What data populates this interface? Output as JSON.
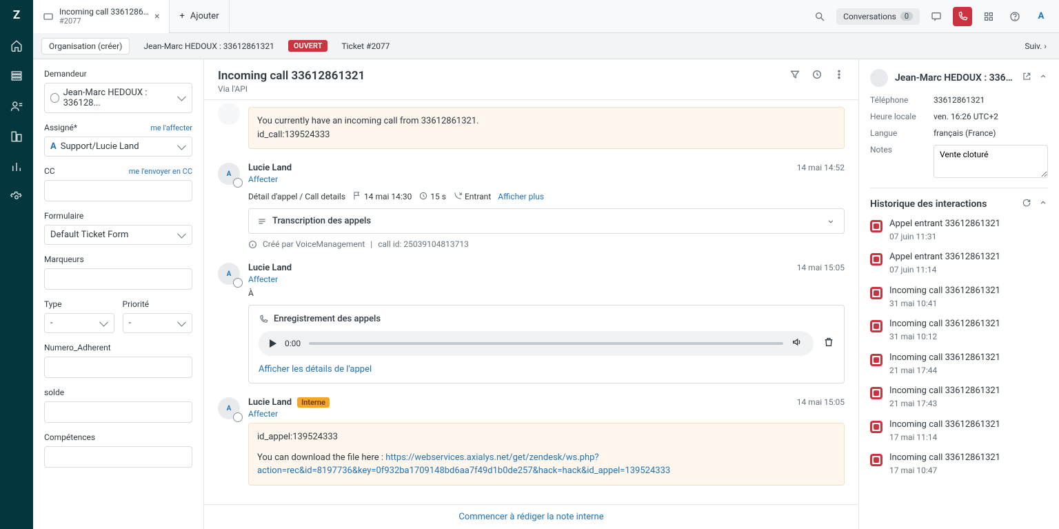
{
  "tab": {
    "title": "Incoming call 3361286...",
    "sub": "#2077",
    "add": "Ajouter"
  },
  "topbar": {
    "conversations": "Conversations",
    "conv_count": "0"
  },
  "crumbs": {
    "org": "Organisation (créer)",
    "user": "Jean-Marc HEDOUX : 33612861321",
    "status": "OUVERT",
    "ticket": "Ticket #2077",
    "next": "Suiv."
  },
  "form": {
    "requester_label": "Demandeur",
    "requester_value": "Jean-Marc HEDOUX : 336128...",
    "assignee_label": "Assigné*",
    "assign_me": "me l'affecter",
    "assignee_value": "Support/Lucie Land",
    "cc_label": "CC",
    "cc_me": "me l'envoyer en CC",
    "form_label": "Formulaire",
    "form_value": "Default Ticket Form",
    "tags_label": "Marqueurs",
    "type_label": "Type",
    "type_value": "-",
    "prio_label": "Priorité",
    "prio_value": "-",
    "num_label": "Numero_Adherent",
    "solde_label": "solde",
    "comp_label": "Compétences"
  },
  "conv": {
    "title": "Incoming call 33612861321",
    "via": "Via l'API",
    "incoming_note_l1": "You currently have an incoming call from 33612861321.",
    "incoming_note_l2": "id_call:139524333",
    "m1": {
      "author": "Lucie Land",
      "ts": "14 mai 14:52",
      "assign": "Affecter",
      "detail": "Détail d'appel / Call details",
      "dt": "14 mai 14:30",
      "dur": "15 s",
      "dir": "Entrant",
      "more": "Afficher plus",
      "trans": "Transcription des appels",
      "created": "Créé par VoiceManagement",
      "callid": "call id: 25039104813713"
    },
    "m2": {
      "author": "Lucie Land",
      "ts": "14 mai 15:05",
      "assign": "Affecter",
      "to": "À",
      "rec_title": "Enregistrement des appels",
      "time": "0:00",
      "details": "Afficher les détails de l'appel"
    },
    "m3": {
      "author": "Lucie Land",
      "ts": "14 mai 15:05",
      "assign": "Affecter",
      "badge": "Interne",
      "l1": "id_appel:139524333",
      "l2": "You can download the file here : ",
      "url": "https://webservices.axialys.net/get/zendesk/ws.php?action=rec&id=8197736&key=0f932ba1709148bd6aa7f49d1b0de257&hack=hack&id_appel=139524333"
    },
    "footer": "Commencer à rédiger la note interne"
  },
  "ctx": {
    "name": "Jean-Marc HEDOUX : 33612...",
    "tel_k": "Téléphone",
    "tel_v": "33612861321",
    "time_k": "Heure locale",
    "time_v": "ven. 16:26 UTC+2",
    "lang_k": "Langue",
    "lang_v": "français (France)",
    "notes_k": "Notes",
    "notes_v": "Vente cloturé",
    "hist_title": "Historique des interactions",
    "hist": [
      {
        "t": "Appel entrant 33612861321",
        "d": "07 juin 11:31"
      },
      {
        "t": "Appel entrant 33612861321",
        "d": "07 juin 11:14"
      },
      {
        "t": "Incoming call 33612861321",
        "d": "31 mai 10:41"
      },
      {
        "t": "Incoming call 33612861321",
        "d": "31 mai 10:12"
      },
      {
        "t": "Incoming call 33612861321",
        "d": "21 mai 17:44"
      },
      {
        "t": "Incoming call 33612861321",
        "d": "21 mai 17:43"
      },
      {
        "t": "Incoming call 33612861321",
        "d": "17 mai 11:14"
      },
      {
        "t": "Incoming call 33612861321",
        "d": "17 mai 10:47"
      }
    ]
  }
}
